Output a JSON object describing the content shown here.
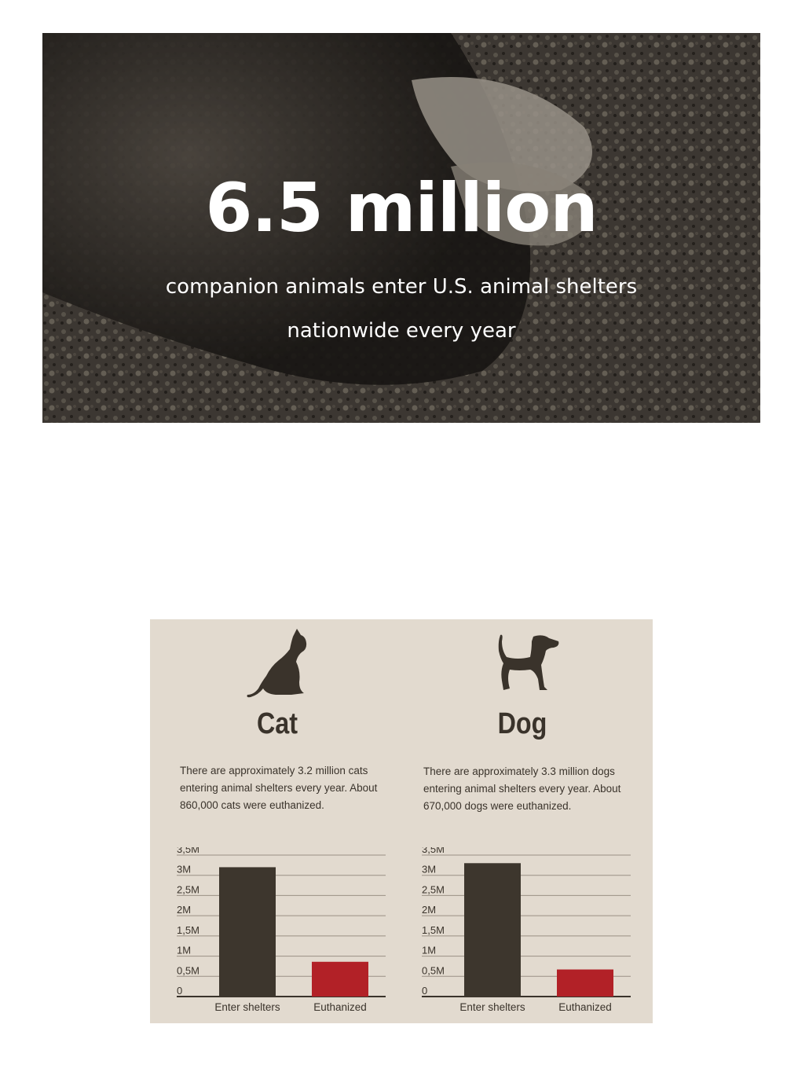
{
  "hero": {
    "headline": "6.5 million",
    "subtitle_line1": "companion animals enter U.S. animal shelters",
    "subtitle_line2": "nationwide every year"
  },
  "colors": {
    "background_panel": "#e2dacf",
    "dark_bar": "#3d362d",
    "red_bar": "#b22127",
    "text": "#3a332b"
  },
  "panels": [
    {
      "title": "Cat",
      "icon": "cat-silhouette-icon",
      "description": "There are approximately 3.2 million cats entering animal shelters every year. About 860,000 cats were euthanized."
    },
    {
      "title": "Dog",
      "icon": "dog-silhouette-icon",
      "description": "There are approximately 3.3 million dogs entering animal shelters every year. About 670,000 dogs were euthanized."
    }
  ],
  "chart_data": [
    {
      "type": "bar",
      "categories": [
        "Enter shelters",
        "Euthanized"
      ],
      "values": [
        3200000,
        860000
      ],
      "colors": [
        "#3d362d",
        "#b22127"
      ],
      "ylim": [
        0,
        3500000
      ],
      "yticks": [
        "0",
        "0,5M",
        "1M",
        "1,5M",
        "2M",
        "2,5M",
        "3M",
        "3,5M"
      ],
      "grid": true
    },
    {
      "type": "bar",
      "categories": [
        "Enter shelters",
        "Euthanized"
      ],
      "values": [
        3300000,
        670000
      ],
      "colors": [
        "#3d362d",
        "#b22127"
      ],
      "ylim": [
        0,
        3500000
      ],
      "yticks": [
        "0",
        "0,5M",
        "1M",
        "1,5M",
        "2M",
        "2,5M",
        "3M",
        "3,5M"
      ],
      "grid": true
    }
  ]
}
